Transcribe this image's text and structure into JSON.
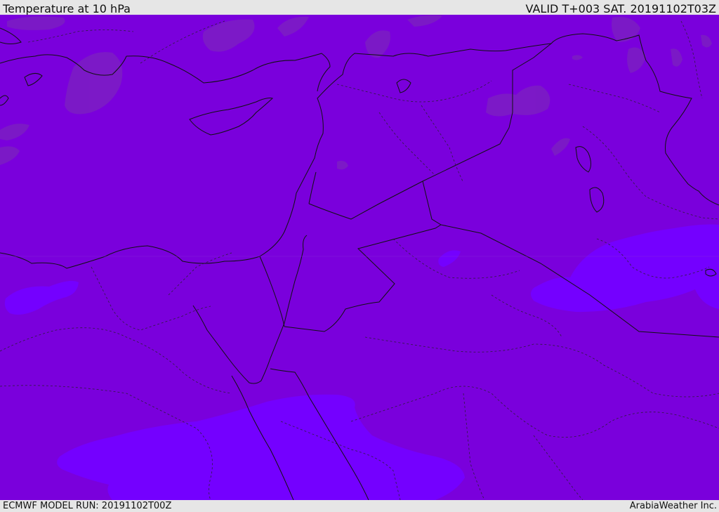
{
  "header": {
    "title": "Temperature at 10 hPa",
    "valid": "VALID T+003 SAT. 20191102T03Z"
  },
  "footer": {
    "model_run": "ECMWF MODEL RUN: 20191102T00Z",
    "credit": "ArabiaWeather Inc."
  },
  "map": {
    "field": "Temperature",
    "level": "10 hPa",
    "colors": {
      "base_fill": "#7a00dc",
      "warm_patch": "#7c1cc4",
      "cool_patch": "#7400ff",
      "coastline": "#111111",
      "border": "#111111"
    }
  }
}
